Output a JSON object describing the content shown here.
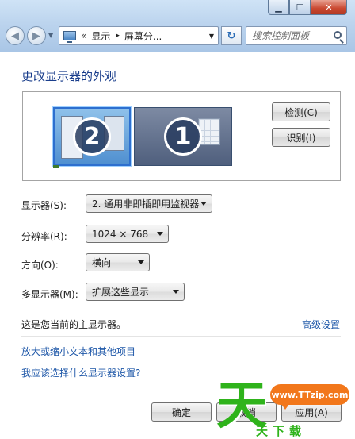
{
  "window": {
    "controls": {
      "minimize": "▁",
      "maximize": "☐",
      "close": "✕"
    }
  },
  "nav": {
    "back_glyph": "◀",
    "forward_glyph": "▶",
    "address": {
      "chevron": "«",
      "crumbs": [
        "显示",
        "屏幕分..."
      ],
      "separator": "▸"
    },
    "search_placeholder": "搜索控制面板"
  },
  "page": {
    "title": "更改显示器的外观",
    "monitors": [
      "2",
      "1"
    ],
    "buttons": {
      "detect": "检测(C)",
      "identify": "识别(I)"
    },
    "fields": [
      {
        "label": "显示器(S):",
        "value": "2. 通用非即插即用监视器"
      },
      {
        "label": "分辨率(R):",
        "value": "1024 × 768"
      },
      {
        "label": "方向(O):",
        "value": "横向"
      },
      {
        "label": "多显示器(M):",
        "value": "扩展这些显示"
      }
    ],
    "main_display_text": "这是您当前的主显示器。",
    "advanced_link": "高级设置",
    "links": [
      "放大或缩小文本和其他项目",
      "我应该选择什么显示器设置?"
    ]
  },
  "footer": {
    "ok": "确定",
    "cancel": "取消",
    "apply": "应用(A)"
  },
  "watermark": {
    "bubble": "www.TTzip.com",
    "logo_char": "天",
    "sub": "天下载"
  },
  "colors": {
    "title": "#1a3e8c",
    "link": "#1e57a8",
    "accent_green": "#2fb31b",
    "accent_orange": "#f2771b"
  }
}
